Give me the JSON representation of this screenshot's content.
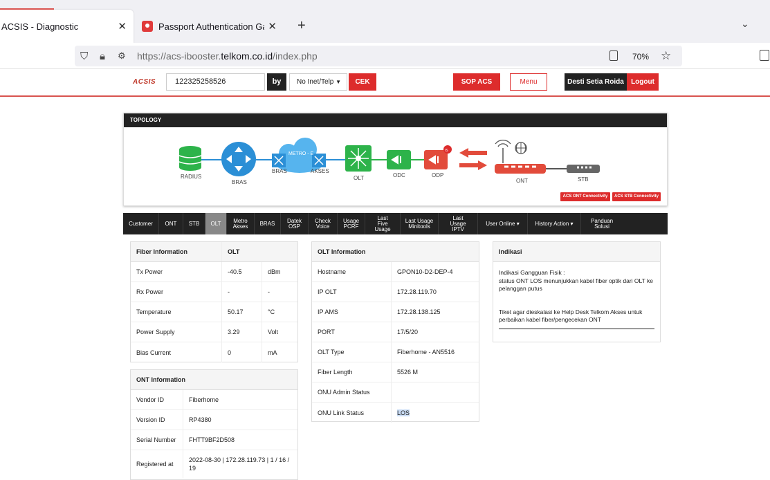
{
  "browser": {
    "tabs": [
      {
        "title": "ACSIS - Diagnostic",
        "active": true
      },
      {
        "title": "Passport Authentication Gatewa",
        "active": false
      }
    ],
    "url_prefix": "https://acs-ibooster.",
    "url_domain": "telkom.co.id",
    "url_path": "/index.php",
    "zoom": "70%"
  },
  "app": {
    "logo": "ACSIS",
    "search_value": "122325258526",
    "by_label": "by",
    "search_type": "No Inet/Telp",
    "cek_label": "CEK",
    "sop_label": "SOP ACS",
    "menu_label": "Menu",
    "user_name": "Desti Setia Roida",
    "logout_label": "Logout"
  },
  "topology": {
    "title": "TOPOLOGY",
    "devices": {
      "radius": "RADIUS",
      "bras": "BRAS",
      "bras2": "BRAS",
      "metro": "METRO - E",
      "akses": "AKSES",
      "olt": "OLT",
      "odc": "ODC",
      "odp": "ODP",
      "ont": "ONT",
      "stb": "STB",
      "odp_badge": "IS"
    },
    "ont_conn_label": "ACS ONT Connectivity",
    "stb_conn_label": "ACS STB Connectivity"
  },
  "tabs": [
    "Customer",
    "ONT",
    "STB",
    "OLT",
    "Metro Akses",
    "BRAS",
    "Datek OSP",
    "Check Voice",
    "Usage PCRF",
    "Last Five Usage",
    "Last Usage Minitools",
    "Last Usage IPTV",
    "User Online ▾",
    "History Action ▾",
    "Panduan Solusi"
  ],
  "fiber": {
    "header_left": "Fiber Information",
    "header_right": "OLT",
    "rows": [
      {
        "label": "Tx Power",
        "value": "-40.5",
        "unit": "dBm"
      },
      {
        "label": "Rx Power",
        "value": "-",
        "unit": "-"
      },
      {
        "label": "Temperature",
        "value": "50.17",
        "unit": "°C"
      },
      {
        "label": "Power Supply",
        "value": "3.29",
        "unit": "Volt"
      },
      {
        "label": "Bias Current",
        "value": "0",
        "unit": "mA"
      }
    ]
  },
  "ont": {
    "header": "ONT Information",
    "rows": [
      {
        "label": "Vendor ID",
        "value": "Fiberhome"
      },
      {
        "label": "Version ID",
        "value": "RP4380"
      },
      {
        "label": "Serial Number",
        "value": "FHTT9BF2D508"
      },
      {
        "label": "Registered at",
        "value": "2022-08-30 | 172.28.119.73 | 1 / 16 / 19"
      }
    ]
  },
  "olt": {
    "header": "OLT Information",
    "rows": [
      {
        "label": "Hostname",
        "value": "GPON10-D2-DEP-4"
      },
      {
        "label": "IP OLT",
        "value": "172.28.119.70"
      },
      {
        "label": "IP AMS",
        "value": "172.28.138.125"
      },
      {
        "label": "PORT",
        "value": "17/5/20"
      },
      {
        "label": "OLT Type",
        "value": "Fiberhome - AN5516"
      },
      {
        "label": "Fiber Length",
        "value": "5526 M"
      },
      {
        "label": "ONU Admin Status",
        "value": ""
      },
      {
        "label": "ONU Link Status",
        "value": "LOS"
      }
    ]
  },
  "indikasi": {
    "header": "Indikasi",
    "line1": "Indikasi Gangguan Fisik :",
    "line2": "status ONT LOS menunjukkan kabel fiber optik dari OLT ke pelanggan putus",
    "line3": "Tiket agar dieskalasi ke Help Desk Telkom Akses untuk perbaikan kabel fiber/pengecekan ONT"
  },
  "colors": {
    "brand_red": "#dd2c2c",
    "dark": "#222222",
    "topology_blue": "#2b8fd6",
    "topology_green": "#2db34a"
  }
}
